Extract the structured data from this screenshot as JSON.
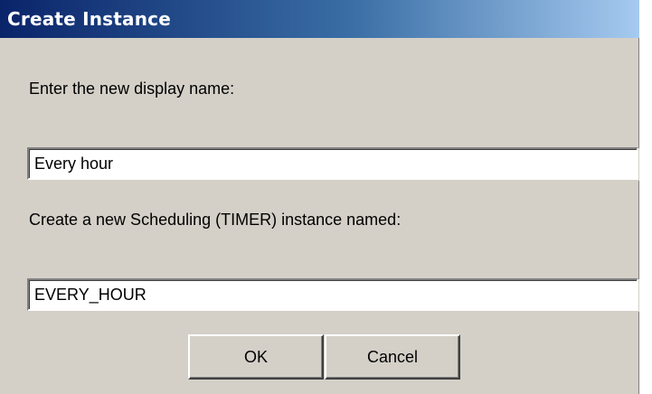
{
  "window": {
    "title": "Create Instance"
  },
  "form": {
    "display_name_label": "Enter the new display name:",
    "display_name_value": "Every hour",
    "instance_label": "Create a new Scheduling (TIMER) instance named:",
    "instance_value": "EVERY_HOUR"
  },
  "buttons": {
    "ok_label": "OK",
    "cancel_label": "Cancel"
  },
  "colors": {
    "title_gradient_start": "#0a246a",
    "title_gradient_end": "#a6caf0",
    "dialog_background": "#d4d0c8"
  }
}
